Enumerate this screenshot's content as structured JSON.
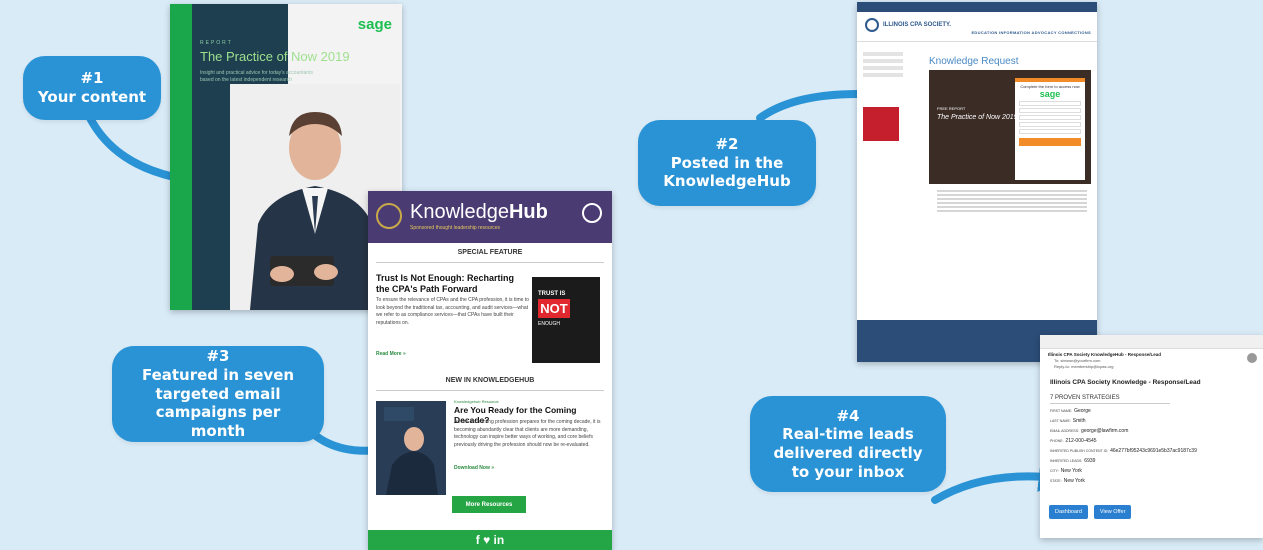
{
  "bubbles": [
    {
      "num": "#1",
      "text": "Your content"
    },
    {
      "num": "#2",
      "text": "Posted in the KnowledgeHub"
    },
    {
      "num": "#3",
      "text": "Featured in seven targeted email campaigns per month"
    },
    {
      "num": "#4",
      "text": "Real-time leads delivered directly to your inbox"
    }
  ],
  "report": {
    "label": "REPORT",
    "title": "The Practice of Now 2019",
    "subtitle": "Insight and practical advice for today's accountants based on the latest independent research",
    "logo": "sage"
  },
  "email": {
    "brand_pre": "Knowledge",
    "brand_bold": "Hub",
    "tagline": "Sponsored thought leadership resources",
    "special_feature": "SPECIAL FEATURE",
    "feature_title": "Trust Is Not Enough: Recharting the CPA's Path Forward",
    "feature_body": "To ensure the relevance of CPAs and the CPA profession, it is time to look beyond the traditional tax, accounting, and audit services—what we refer to as compliance services—that CPAs have built their reputations on.",
    "feature_link": "Read More »",
    "book_line1": "TRUST IS",
    "book_line2": "NOT",
    "book_line3": "ENOUGH",
    "new_in": "NEW IN KNOWLEDGEHUB",
    "item_tag": "Knowledgehub Resource",
    "item_title": "Are You Ready for the Coming Decade?",
    "item_body": "As the accounting profession prepares for the coming decade, it is becoming abundantly clear that clients are more demanding, technology can inspire better ways of working, and core beliefs previously driving the profession should now be re-evaluated.",
    "item_link": "Download Now »",
    "more_button": "More Resources",
    "social": "f ♥ in"
  },
  "site": {
    "logo_text": "ILLINOIS CPA SOCIETY.",
    "nav": "EDUCATION   INFORMATION   ADVOCACY   CONNECTIONS",
    "title": "Knowledge Request",
    "hero_label": "FREE REPORT",
    "hero_title": "The Practice of Now 2019",
    "form_head": "Complete the form to access now",
    "form_logo": "sage"
  },
  "lead": {
    "from": "Illinois CPA Society KnowledgeHub - Response/Lead",
    "to": "To: sbrown@yourfirm.com",
    "reply": "Reply-to: membership@icpas.org",
    "subject": "Illinois CPA Society Knowledge - Response/Lead",
    "campaign": "7 PROVEN STRATEGIES",
    "fields": [
      {
        "k": "First Name:",
        "v": "George"
      },
      {
        "k": "Last Name:",
        "v": "Smith"
      },
      {
        "k": "Email Address:",
        "v": "george@lawfirm.com"
      },
      {
        "k": "Phone:",
        "v": "212-000-4545"
      },
      {
        "k": "Inherited Publish Content ID:",
        "v": "46e277bf95243c9691e5b37ac9187c39"
      },
      {
        "k": "Inherited Leads:",
        "v": "6939"
      },
      {
        "k": "City:",
        "v": "New York"
      },
      {
        "k": "State:",
        "v": "New York"
      }
    ],
    "dashboard_button": "Dashboard",
    "view_offer_button": "View Offer"
  },
  "colors": {
    "background": "#d9ebf7",
    "bubble": "#2a93d6",
    "arrow": "#2a93d6",
    "hub_header": "#4a3b73",
    "accent_green": "#25a544"
  }
}
